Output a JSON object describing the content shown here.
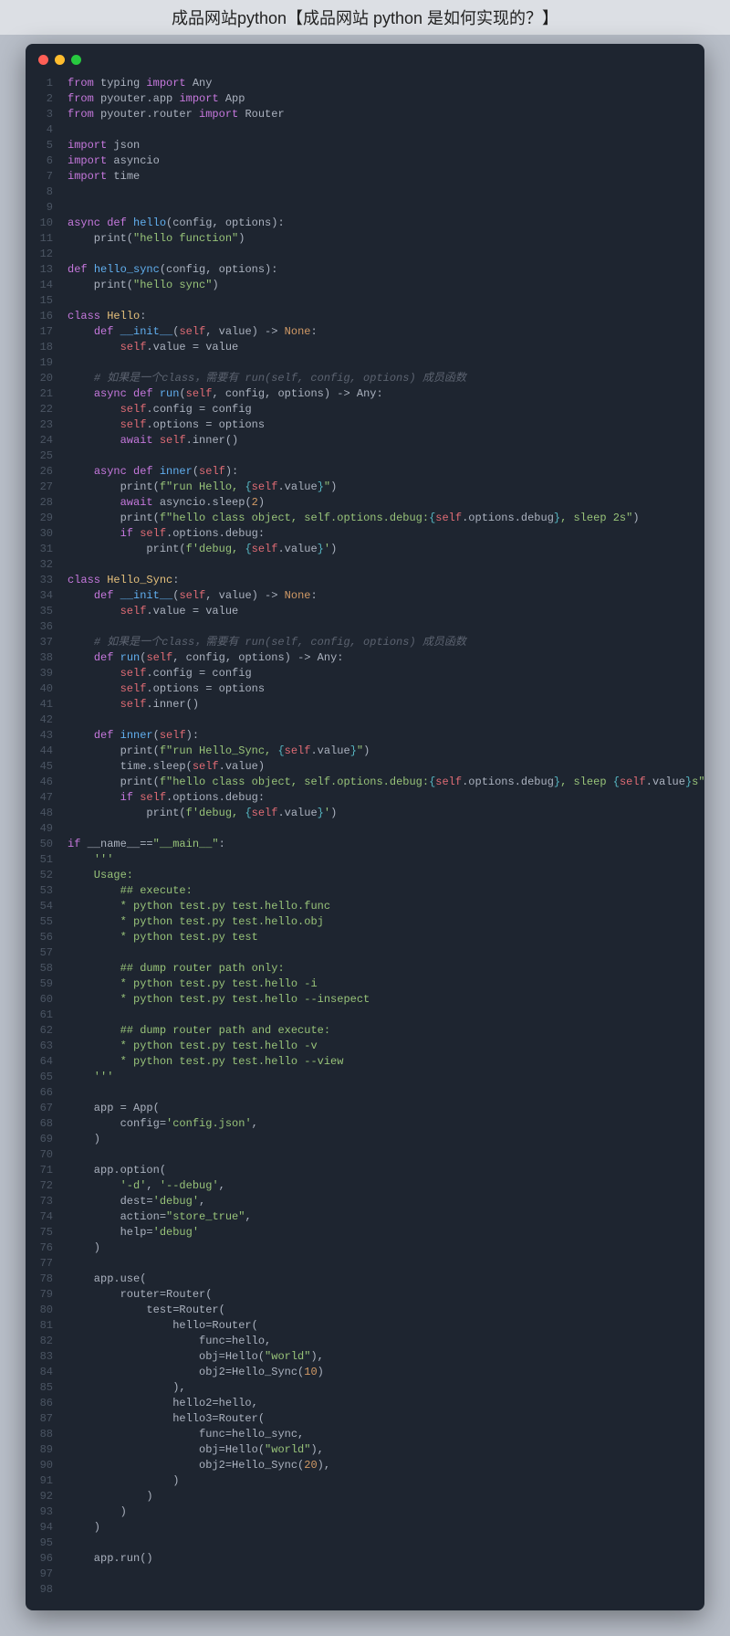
{
  "title": "成品网站python【成品网站 python 是如何实现的？】",
  "lines": [
    [
      {
        "t": "from",
        "c": "k"
      },
      {
        "t": " typing ",
        "c": ""
      },
      {
        "t": "import",
        "c": "k"
      },
      {
        "t": " Any",
        "c": ""
      }
    ],
    [
      {
        "t": "from",
        "c": "k"
      },
      {
        "t": " pyouter.app ",
        "c": ""
      },
      {
        "t": "import",
        "c": "k"
      },
      {
        "t": " App",
        "c": ""
      }
    ],
    [
      {
        "t": "from",
        "c": "k"
      },
      {
        "t": " pyouter.router ",
        "c": ""
      },
      {
        "t": "import",
        "c": "k"
      },
      {
        "t": " Router",
        "c": ""
      }
    ],
    [],
    [
      {
        "t": "import",
        "c": "k"
      },
      {
        "t": " json",
        "c": ""
      }
    ],
    [
      {
        "t": "import",
        "c": "k"
      },
      {
        "t": " asyncio",
        "c": ""
      }
    ],
    [
      {
        "t": "import",
        "c": "k"
      },
      {
        "t": " time",
        "c": ""
      }
    ],
    [],
    [],
    [
      {
        "t": "async def ",
        "c": "k"
      },
      {
        "t": "hello",
        "c": "f"
      },
      {
        "t": "(config, options):",
        "c": ""
      }
    ],
    [
      {
        "t": "    print(",
        "c": ""
      },
      {
        "t": "\"hello function\"",
        "c": "s"
      },
      {
        "t": ")",
        "c": ""
      }
    ],
    [],
    [
      {
        "t": "def ",
        "c": "k"
      },
      {
        "t": "hello_sync",
        "c": "f"
      },
      {
        "t": "(config, options):",
        "c": ""
      }
    ],
    [
      {
        "t": "    print(",
        "c": ""
      },
      {
        "t": "\"hello sync\"",
        "c": "s"
      },
      {
        "t": ")",
        "c": ""
      }
    ],
    [],
    [
      {
        "t": "class ",
        "c": "k"
      },
      {
        "t": "Hello",
        "c": "sl"
      },
      {
        "t": ":",
        "c": ""
      }
    ],
    [
      {
        "t": "    ",
        "c": ""
      },
      {
        "t": "def ",
        "c": "k"
      },
      {
        "t": "__init__",
        "c": "f"
      },
      {
        "t": "(",
        "c": ""
      },
      {
        "t": "self",
        "c": "v"
      },
      {
        "t": ", value) -> ",
        "c": ""
      },
      {
        "t": "None",
        "c": "p"
      },
      {
        "t": ":",
        "c": ""
      }
    ],
    [
      {
        "t": "        ",
        "c": ""
      },
      {
        "t": "self",
        "c": "v"
      },
      {
        "t": ".value = value",
        "c": ""
      }
    ],
    [],
    [
      {
        "t": "    ",
        "c": ""
      },
      {
        "t": "# 如果是一个class，需要有 run(self, config, options) 成员函数",
        "c": "c"
      }
    ],
    [
      {
        "t": "    ",
        "c": ""
      },
      {
        "t": "async def ",
        "c": "k"
      },
      {
        "t": "run",
        "c": "f"
      },
      {
        "t": "(",
        "c": ""
      },
      {
        "t": "self",
        "c": "v"
      },
      {
        "t": ", config, options) -> Any:",
        "c": ""
      }
    ],
    [
      {
        "t": "        ",
        "c": ""
      },
      {
        "t": "self",
        "c": "v"
      },
      {
        "t": ".config = config",
        "c": ""
      }
    ],
    [
      {
        "t": "        ",
        "c": ""
      },
      {
        "t": "self",
        "c": "v"
      },
      {
        "t": ".options = options",
        "c": ""
      }
    ],
    [
      {
        "t": "        ",
        "c": ""
      },
      {
        "t": "await ",
        "c": "k"
      },
      {
        "t": "self",
        "c": "v"
      },
      {
        "t": ".inner()",
        "c": ""
      }
    ],
    [],
    [
      {
        "t": "    ",
        "c": ""
      },
      {
        "t": "async def ",
        "c": "k"
      },
      {
        "t": "inner",
        "c": "f"
      },
      {
        "t": "(",
        "c": ""
      },
      {
        "t": "self",
        "c": "v"
      },
      {
        "t": "):",
        "c": ""
      }
    ],
    [
      {
        "t": "        print(",
        "c": ""
      },
      {
        "t": "f\"run Hello, ",
        "c": "s"
      },
      {
        "t": "{",
        "c": "b"
      },
      {
        "t": "self",
        "c": "v"
      },
      {
        "t": ".value",
        "c": ""
      },
      {
        "t": "}",
        "c": "b"
      },
      {
        "t": "\"",
        "c": "s"
      },
      {
        "t": ")",
        "c": ""
      }
    ],
    [
      {
        "t": "        ",
        "c": ""
      },
      {
        "t": "await ",
        "c": "k"
      },
      {
        "t": "asyncio.sleep(",
        "c": ""
      },
      {
        "t": "2",
        "c": "p"
      },
      {
        "t": ")",
        "c": ""
      }
    ],
    [
      {
        "t": "        print(",
        "c": ""
      },
      {
        "t": "f\"hello class object, self.options.debug:",
        "c": "s"
      },
      {
        "t": "{",
        "c": "b"
      },
      {
        "t": "self",
        "c": "v"
      },
      {
        "t": ".options.debug",
        "c": ""
      },
      {
        "t": "}",
        "c": "b"
      },
      {
        "t": ", sleep 2s\"",
        "c": "s"
      },
      {
        "t": ")",
        "c": ""
      }
    ],
    [
      {
        "t": "        ",
        "c": ""
      },
      {
        "t": "if ",
        "c": "k"
      },
      {
        "t": "self",
        "c": "v"
      },
      {
        "t": ".options.debug:",
        "c": ""
      }
    ],
    [
      {
        "t": "            print(",
        "c": ""
      },
      {
        "t": "f'debug, ",
        "c": "s"
      },
      {
        "t": "{",
        "c": "b"
      },
      {
        "t": "self",
        "c": "v"
      },
      {
        "t": ".value",
        "c": ""
      },
      {
        "t": "}",
        "c": "b"
      },
      {
        "t": "'",
        "c": "s"
      },
      {
        "t": ")",
        "c": ""
      }
    ],
    [],
    [
      {
        "t": "class ",
        "c": "k"
      },
      {
        "t": "Hello_Sync",
        "c": "sl"
      },
      {
        "t": ":",
        "c": ""
      }
    ],
    [
      {
        "t": "    ",
        "c": ""
      },
      {
        "t": "def ",
        "c": "k"
      },
      {
        "t": "__init__",
        "c": "f"
      },
      {
        "t": "(",
        "c": ""
      },
      {
        "t": "self",
        "c": "v"
      },
      {
        "t": ", value) -> ",
        "c": ""
      },
      {
        "t": "None",
        "c": "p"
      },
      {
        "t": ":",
        "c": ""
      }
    ],
    [
      {
        "t": "        ",
        "c": ""
      },
      {
        "t": "self",
        "c": "v"
      },
      {
        "t": ".value = value",
        "c": ""
      }
    ],
    [],
    [
      {
        "t": "    ",
        "c": ""
      },
      {
        "t": "# 如果是一个class，需要有 run(self, config, options) 成员函数",
        "c": "c"
      }
    ],
    [
      {
        "t": "    ",
        "c": ""
      },
      {
        "t": "def ",
        "c": "k"
      },
      {
        "t": "run",
        "c": "f"
      },
      {
        "t": "(",
        "c": ""
      },
      {
        "t": "self",
        "c": "v"
      },
      {
        "t": ", config, options) -> Any:",
        "c": ""
      }
    ],
    [
      {
        "t": "        ",
        "c": ""
      },
      {
        "t": "self",
        "c": "v"
      },
      {
        "t": ".config = config",
        "c": ""
      }
    ],
    [
      {
        "t": "        ",
        "c": ""
      },
      {
        "t": "self",
        "c": "v"
      },
      {
        "t": ".options = options",
        "c": ""
      }
    ],
    [
      {
        "t": "        ",
        "c": ""
      },
      {
        "t": "self",
        "c": "v"
      },
      {
        "t": ".inner()",
        "c": ""
      }
    ],
    [],
    [
      {
        "t": "    ",
        "c": ""
      },
      {
        "t": "def ",
        "c": "k"
      },
      {
        "t": "inner",
        "c": "f"
      },
      {
        "t": "(",
        "c": ""
      },
      {
        "t": "self",
        "c": "v"
      },
      {
        "t": "):",
        "c": ""
      }
    ],
    [
      {
        "t": "        print(",
        "c": ""
      },
      {
        "t": "f\"run Hello_Sync, ",
        "c": "s"
      },
      {
        "t": "{",
        "c": "b"
      },
      {
        "t": "self",
        "c": "v"
      },
      {
        "t": ".value",
        "c": ""
      },
      {
        "t": "}",
        "c": "b"
      },
      {
        "t": "\"",
        "c": "s"
      },
      {
        "t": ")",
        "c": ""
      }
    ],
    [
      {
        "t": "        time.sleep(",
        "c": ""
      },
      {
        "t": "self",
        "c": "v"
      },
      {
        "t": ".value)",
        "c": ""
      }
    ],
    [
      {
        "t": "        print(",
        "c": ""
      },
      {
        "t": "f\"hello class object, self.options.debug:",
        "c": "s"
      },
      {
        "t": "{",
        "c": "b"
      },
      {
        "t": "self",
        "c": "v"
      },
      {
        "t": ".options.debug",
        "c": ""
      },
      {
        "t": "}",
        "c": "b"
      },
      {
        "t": ", sleep ",
        "c": "s"
      },
      {
        "t": "{",
        "c": "b"
      },
      {
        "t": "self",
        "c": "v"
      },
      {
        "t": ".value",
        "c": ""
      },
      {
        "t": "}",
        "c": "b"
      },
      {
        "t": "s\"",
        "c": "s"
      },
      {
        "t": ")",
        "c": ""
      }
    ],
    [
      {
        "t": "        ",
        "c": ""
      },
      {
        "t": "if ",
        "c": "k"
      },
      {
        "t": "self",
        "c": "v"
      },
      {
        "t": ".options.debug:",
        "c": ""
      }
    ],
    [
      {
        "t": "            print(",
        "c": ""
      },
      {
        "t": "f'debug, ",
        "c": "s"
      },
      {
        "t": "{",
        "c": "b"
      },
      {
        "t": "self",
        "c": "v"
      },
      {
        "t": ".value",
        "c": ""
      },
      {
        "t": "}",
        "c": "b"
      },
      {
        "t": "'",
        "c": "s"
      },
      {
        "t": ")",
        "c": ""
      }
    ],
    [],
    [
      {
        "t": "if ",
        "c": "k"
      },
      {
        "t": "__name__==",
        "c": ""
      },
      {
        "t": "\"__main__\"",
        "c": "s"
      },
      {
        "t": ":",
        "c": ""
      }
    ],
    [
      {
        "t": "    ",
        "c": ""
      },
      {
        "t": "'''",
        "c": "s"
      }
    ],
    [
      {
        "t": "    Usage:",
        "c": "s"
      }
    ],
    [
      {
        "t": "        ## execute:",
        "c": "s"
      }
    ],
    [
      {
        "t": "        * python test.py test.hello.func",
        "c": "s"
      }
    ],
    [
      {
        "t": "        * python test.py test.hello.obj",
        "c": "s"
      }
    ],
    [
      {
        "t": "        * python test.py test",
        "c": "s"
      }
    ],
    [
      {
        "t": "",
        "c": "s"
      }
    ],
    [
      {
        "t": "        ## dump router path only:",
        "c": "s"
      }
    ],
    [
      {
        "t": "        * python test.py test.hello -i",
        "c": "s"
      }
    ],
    [
      {
        "t": "        * python test.py test.hello --insepect",
        "c": "s"
      }
    ],
    [
      {
        "t": "",
        "c": "s"
      }
    ],
    [
      {
        "t": "        ## dump router path and execute:",
        "c": "s"
      }
    ],
    [
      {
        "t": "        * python test.py test.hello -v",
        "c": "s"
      }
    ],
    [
      {
        "t": "        * python test.py test.hello --view",
        "c": "s"
      }
    ],
    [
      {
        "t": "    '''",
        "c": "s"
      }
    ],
    [],
    [
      {
        "t": "    app = App(",
        "c": ""
      }
    ],
    [
      {
        "t": "        config=",
        "c": ""
      },
      {
        "t": "'config.json'",
        "c": "s"
      },
      {
        "t": ",",
        "c": ""
      }
    ],
    [
      {
        "t": "    )",
        "c": ""
      }
    ],
    [],
    [
      {
        "t": "    app.option(",
        "c": ""
      }
    ],
    [
      {
        "t": "        ",
        "c": ""
      },
      {
        "t": "'-d'",
        "c": "s"
      },
      {
        "t": ", ",
        "c": ""
      },
      {
        "t": "'--debug'",
        "c": "s"
      },
      {
        "t": ",",
        "c": ""
      }
    ],
    [
      {
        "t": "        dest=",
        "c": ""
      },
      {
        "t": "'debug'",
        "c": "s"
      },
      {
        "t": ",",
        "c": ""
      }
    ],
    [
      {
        "t": "        action=",
        "c": ""
      },
      {
        "t": "\"store_true\"",
        "c": "s"
      },
      {
        "t": ",",
        "c": ""
      }
    ],
    [
      {
        "t": "        help=",
        "c": ""
      },
      {
        "t": "'debug'",
        "c": "s"
      }
    ],
    [
      {
        "t": "    )",
        "c": ""
      }
    ],
    [],
    [
      {
        "t": "    app.use(",
        "c": ""
      }
    ],
    [
      {
        "t": "        router=Router(",
        "c": ""
      }
    ],
    [
      {
        "t": "            test=Router(",
        "c": ""
      }
    ],
    [
      {
        "t": "                hello=Router(",
        "c": ""
      }
    ],
    [
      {
        "t": "                    func=hello,",
        "c": ""
      }
    ],
    [
      {
        "t": "                    obj=Hello(",
        "c": ""
      },
      {
        "t": "\"world\"",
        "c": "s"
      },
      {
        "t": "),",
        "c": ""
      }
    ],
    [
      {
        "t": "                    obj2=Hello_Sync(",
        "c": ""
      },
      {
        "t": "10",
        "c": "p"
      },
      {
        "t": ")",
        "c": ""
      }
    ],
    [
      {
        "t": "                ),",
        "c": ""
      }
    ],
    [
      {
        "t": "                hello2=hello,",
        "c": ""
      }
    ],
    [
      {
        "t": "                hello3=Router(",
        "c": ""
      }
    ],
    [
      {
        "t": "                    func=hello_sync,",
        "c": ""
      }
    ],
    [
      {
        "t": "                    obj=Hello(",
        "c": ""
      },
      {
        "t": "\"world\"",
        "c": "s"
      },
      {
        "t": "),",
        "c": ""
      }
    ],
    [
      {
        "t": "                    obj2=Hello_Sync(",
        "c": ""
      },
      {
        "t": "20",
        "c": "p"
      },
      {
        "t": "),",
        "c": ""
      }
    ],
    [
      {
        "t": "                )",
        "c": ""
      }
    ],
    [
      {
        "t": "            )",
        "c": ""
      }
    ],
    [
      {
        "t": "        )",
        "c": ""
      }
    ],
    [
      {
        "t": "    )",
        "c": ""
      }
    ],
    [],
    [
      {
        "t": "    app.run()",
        "c": ""
      }
    ],
    [],
    []
  ]
}
